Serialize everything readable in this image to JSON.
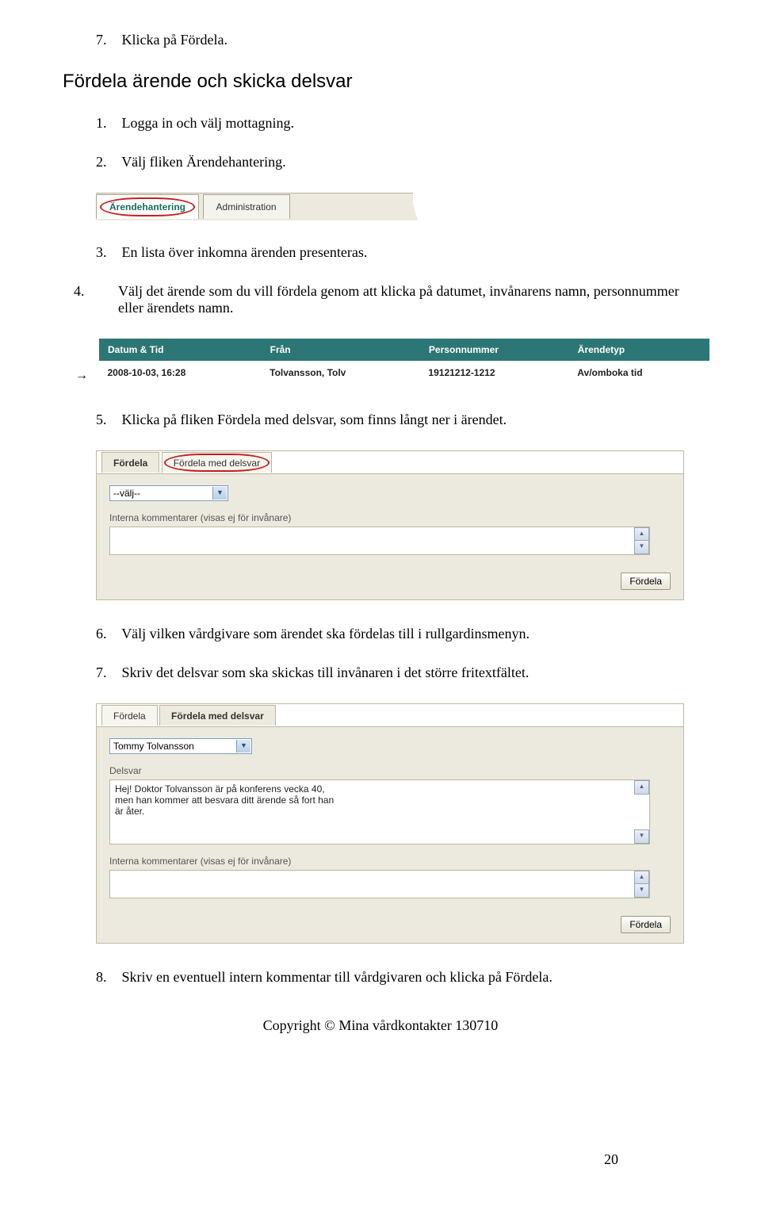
{
  "topStep": {
    "num": "7.",
    "text": "Klicka på Fördela."
  },
  "sectionHeading": "Fördela ärende och skicka delsvar",
  "steps12": [
    {
      "num": "1.",
      "text": "Logga in och välj mottagning."
    },
    {
      "num": "2.",
      "text": "Välj fliken Ärendehantering."
    }
  ],
  "tabBar": {
    "activeTab": "Ärendehantering",
    "otherTab": "Administration"
  },
  "step3": {
    "num": "3.",
    "text": "En lista över inkomna ärenden presenteras."
  },
  "step4": {
    "num": "4.",
    "text": "Välj det ärende som du vill fördela genom att klicka på datumet, invånarens namn, personnummer eller ärendets namn."
  },
  "table": {
    "headers": [
      "Datum & Tid",
      "Från",
      "Personnummer",
      "Ärendetyp"
    ],
    "row": [
      "2008-10-03, 16:28",
      "Tolvansson, Tolv",
      "19121212-1212",
      "Av/omboka tid"
    ]
  },
  "step5": {
    "num": "5.",
    "text": "Klicka på fliken Fördela med delsvar, som finns långt ner i ärendet."
  },
  "panel1": {
    "tabA": "Fördela",
    "tabB": "Fördela med delsvar",
    "selectValue": "--välj--",
    "commentLabel": "Interna kommentarer (visas ej för invånare)",
    "button": "Fördela"
  },
  "step6": {
    "num": "6.",
    "text": "Välj vilken vårdgivare som ärendet ska fördelas till i rullgardinsmenyn."
  },
  "step7": {
    "num": "7.",
    "text": "Skriv det delsvar som ska skickas till invånaren i det större fritextfältet."
  },
  "panel2": {
    "tabA": "Fördela",
    "tabB": "Fördela med delsvar",
    "selectValue": "Tommy Tolvansson",
    "delsvarLabel": "Delsvar",
    "delsvarText": "Hej! Doktor Tolvansson är på konferens vecka 40,\nmen han kommer att besvara ditt ärende så fort han\när åter.",
    "commentLabel": "Interna kommentarer (visas ej för invånare)",
    "button": "Fördela"
  },
  "step8": {
    "num": "8.",
    "text": "Skriv en eventuell intern kommentar till vårdgivaren och klicka på Fördela."
  },
  "footer": "Copyright © Mina vårdkontakter 130710",
  "pageNum": "20"
}
